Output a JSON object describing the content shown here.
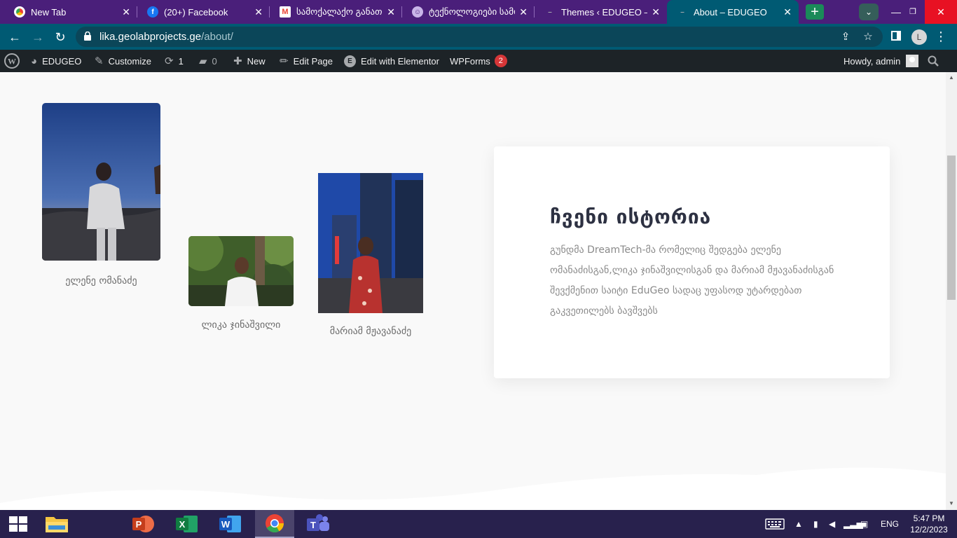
{
  "browser": {
    "tabs": [
      {
        "title": "New Tab",
        "icon": "chrome-icon"
      },
      {
        "title": "(20+) Facebook",
        "icon": "facebook-icon"
      },
      {
        "title": "სამოქალაქო განათლ",
        "icon": "gmail-icon"
      },
      {
        "title": "ტექნოლოგიები სამო",
        "icon": "site-icon"
      },
      {
        "title": "Themes ‹ EDUGEO — W",
        "icon": "wordpress-icon"
      },
      {
        "title": "About – EDUGEO",
        "icon": "wordpress-icon"
      }
    ],
    "active_tab": 5,
    "url_host": "lika.geolabprojects.ge",
    "url_path": "/about/",
    "profile_initial": "L"
  },
  "adminbar": {
    "site_name": "EDUGEO",
    "customize": "Customize",
    "updates": "1",
    "comments": "0",
    "new": "New",
    "edit_page": "Edit Page",
    "edit_elementor": "Edit with Elementor",
    "wpforms": "WPForms",
    "wpforms_count": "2",
    "howdy": "Howdy, admin"
  },
  "team": [
    {
      "name": "ელენე ომანაძე"
    },
    {
      "name": "ლიკა ჯინაშვილი"
    },
    {
      "name": "მარიამ მჟავანაძე"
    }
  ],
  "story": {
    "heading": "ჩვენი ისტორია",
    "body": "გუნდმა DreamTech-მა რომელიც შედგება ელენე ომანაძისგან,ლიკა ჯინაშვილისგან და მარიამ მჟავანაძისგან შევქმენით საიტი EduGeo სადაც უფასოდ უტარდებათ გაკვეთილებს ბავშვებს"
  },
  "taskbar": {
    "language": "ENG",
    "time": "5:47 PM",
    "date": "12/2/2023"
  },
  "colors": {
    "tab_strip": "#4a1f7a",
    "toolbar": "#005a73",
    "admin_bar": "#1d2327",
    "badge": "#d63638",
    "heading": "#2d3142",
    "taskbar": "#28214d"
  }
}
